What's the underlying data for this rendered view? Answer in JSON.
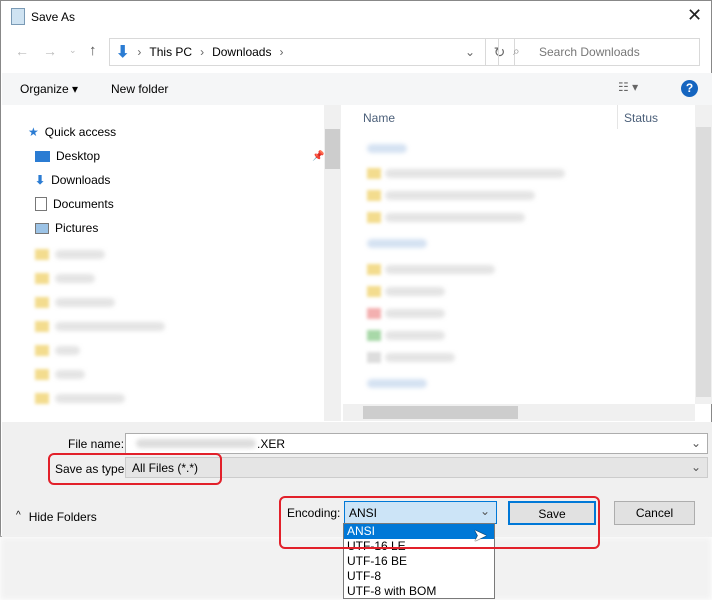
{
  "window": {
    "title": "Save As",
    "close": "✕"
  },
  "address": {
    "crumbs": [
      "This PC",
      "Downloads"
    ],
    "search_placeholder": "Search Downloads"
  },
  "toolbar": {
    "organize": "Organize ▾",
    "new_folder": "New folder",
    "help": "?"
  },
  "nav": {
    "quick_access": "Quick access",
    "items": [
      "Desktop",
      "Downloads",
      "Documents",
      "Pictures"
    ]
  },
  "list": {
    "columns": [
      "Name",
      "Status"
    ]
  },
  "form": {
    "file_name_label": "File name:",
    "file_name_value": ".XER",
    "type_label": "Save as type:",
    "type_value": "All Files  (*.*)",
    "encoding_label": "Encoding:",
    "encoding_value": "ANSI",
    "save": "Save",
    "cancel": "Cancel",
    "hide_folders": "Hide Folders"
  },
  "encoding_options": [
    "ANSI",
    "UTF-16 LE",
    "UTF-16 BE",
    "UTF-8",
    "UTF-8 with BOM"
  ],
  "colors": {
    "accent": "#0078d7",
    "highlight": "#e2202a"
  }
}
